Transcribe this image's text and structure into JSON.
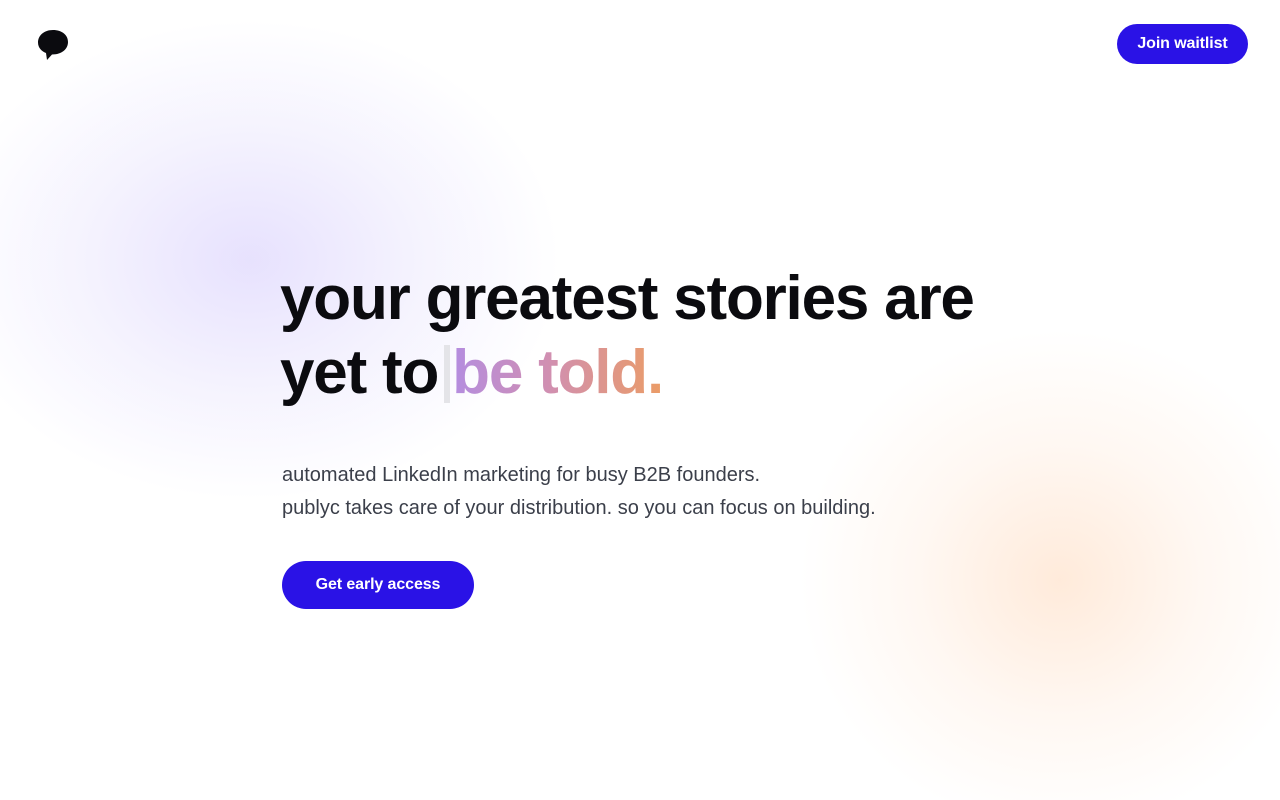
{
  "brand": {
    "logo_icon": "speech-bubble-icon"
  },
  "header": {
    "cta_label": "Join waitlist"
  },
  "hero": {
    "headline_line1": "your greatest stories are",
    "headline_line2_prefix": "yet to",
    "headline_line2_highlight": "be told.",
    "subtitle_line1": "automated LinkedIn marketing for busy B2B founders.",
    "subtitle_line2": "publyc takes care of your distribution. so you can focus on building.",
    "cta_label": "Get early access"
  },
  "colors": {
    "accent": "#2a12e6",
    "text": "#0b0b0f",
    "muted_text": "#3b3f4a",
    "highlight_gradient_start": "#b48de0",
    "highlight_gradient_end": "#eb9c66"
  }
}
